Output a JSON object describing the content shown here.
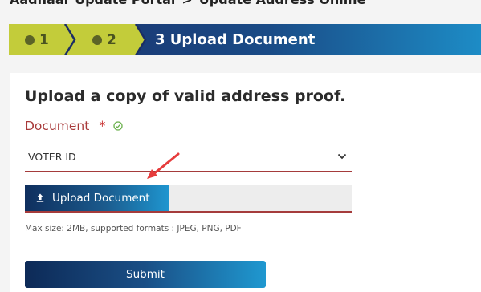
{
  "breadcrumb": {
    "parent": "Aadhaar Update Portal",
    "separator": ">",
    "current": "Update Address Online"
  },
  "stepper": {
    "steps": [
      {
        "label": "1",
        "state": "done"
      },
      {
        "label": "2",
        "state": "done"
      },
      {
        "label": "3 Upload Document",
        "state": "current"
      }
    ],
    "colors": {
      "done": "#c3cc3a",
      "current_start": "#1a2f6a",
      "current_end": "#1d8cc6"
    }
  },
  "form": {
    "title": "Upload a copy of valid address proof.",
    "document_label": "Document",
    "required_mark": "*",
    "selected_document": "VOTER ID",
    "upload_button": "Upload Document",
    "hint": "Max size: 2MB, supported formats : JPEG, PNG, PDF",
    "submit_button": "Submit"
  },
  "icons": {
    "done_step": "check-circle-icon",
    "valid_field": "check-circle-outline-icon",
    "dropdown": "chevron-down-icon",
    "upload": "upload-icon",
    "annotation": "red-arrow-icon"
  }
}
